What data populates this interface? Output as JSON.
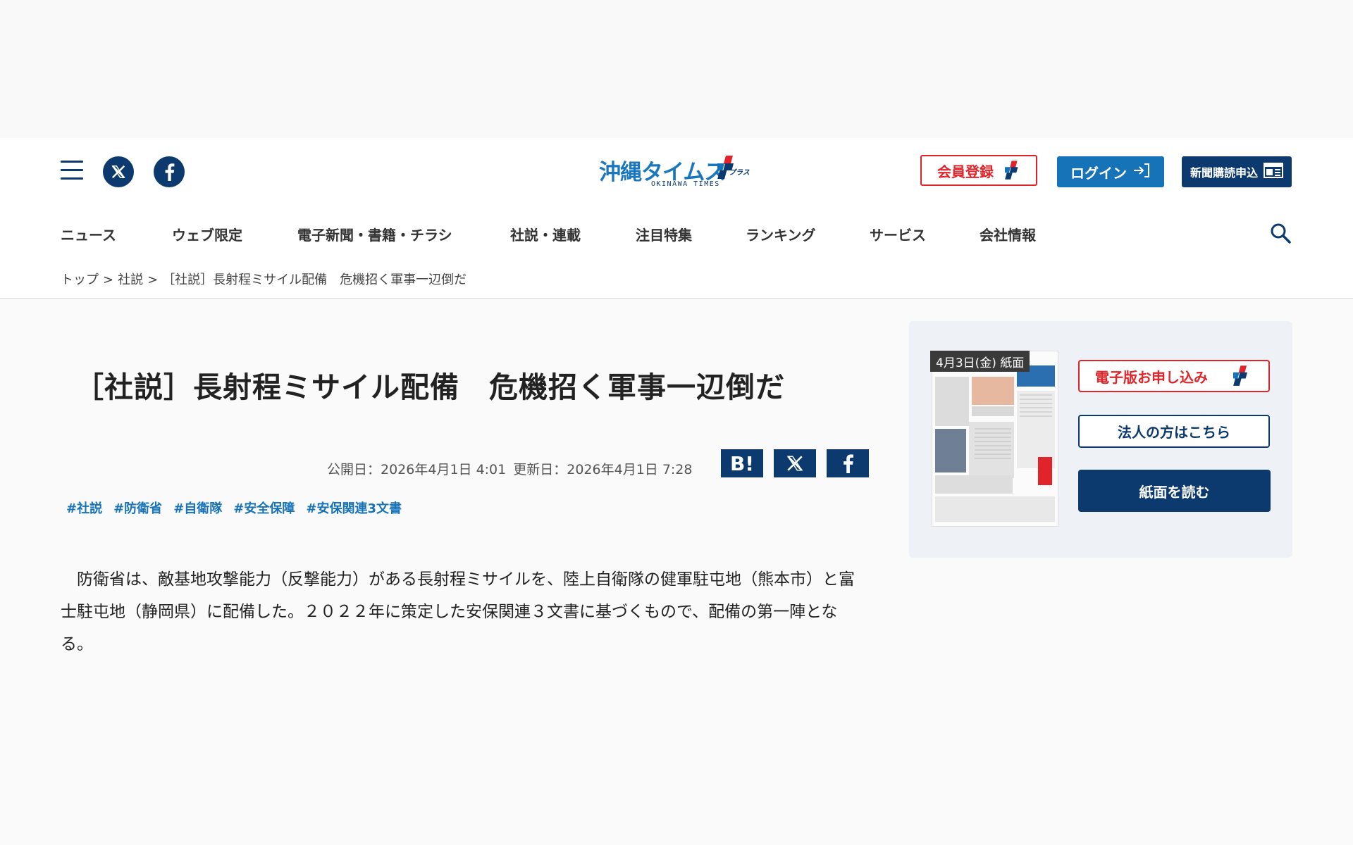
{
  "header": {
    "logo_text": "沖縄タイムス",
    "logo_sub": "OKINAWA TIMES",
    "plus_label": "プラス",
    "register_label": "会員登録",
    "login_label": "ログイン",
    "subscribe_label": "新聞購読申込"
  },
  "nav": {
    "items": [
      {
        "label": "ニュース"
      },
      {
        "label": "ウェブ限定"
      },
      {
        "label": "電子新聞・書籍・チラシ"
      },
      {
        "label": "社説・連載"
      },
      {
        "label": "注目特集"
      },
      {
        "label": "ランキング"
      },
      {
        "label": "サービス"
      },
      {
        "label": "会社情報"
      }
    ]
  },
  "breadcrumb": {
    "items": [
      "トップ",
      "社説",
      "［社説］長射程ミサイル配備　危機招く軍事一辺倒だ"
    ],
    "separator": ">"
  },
  "article": {
    "title": "［社説］長射程ミサイル配備　危機招く軍事一辺倒だ",
    "published": "公開日：2026年4月1日 4:01",
    "updated": "更新日：2026年4月1日 7:28",
    "share": {
      "hatena": "B!"
    },
    "tags": [
      "#社説",
      "#防衛省",
      "#自衛隊",
      "#安全保障",
      "#安保関連3文書"
    ],
    "body": "　防衛省は、敵基地攻撃能力（反撃能力）がある長射程ミサイルを、陸上自衛隊の健軍駐屯地（熊本市）と富士駐屯地（静岡県）に配備した。２０２２年に策定した安保関連３文書に基づくもので、配備の第一陣となる。"
  },
  "sidebar": {
    "paper_date": "4月3日(金) 紙面",
    "apply_label": "電子版お申し込み",
    "corp_label": "法人の方はこちら",
    "read_label": "紙面を読む"
  },
  "colors": {
    "navy": "#0d3a6e",
    "blue": "#1773b7",
    "red": "#e1242a"
  }
}
